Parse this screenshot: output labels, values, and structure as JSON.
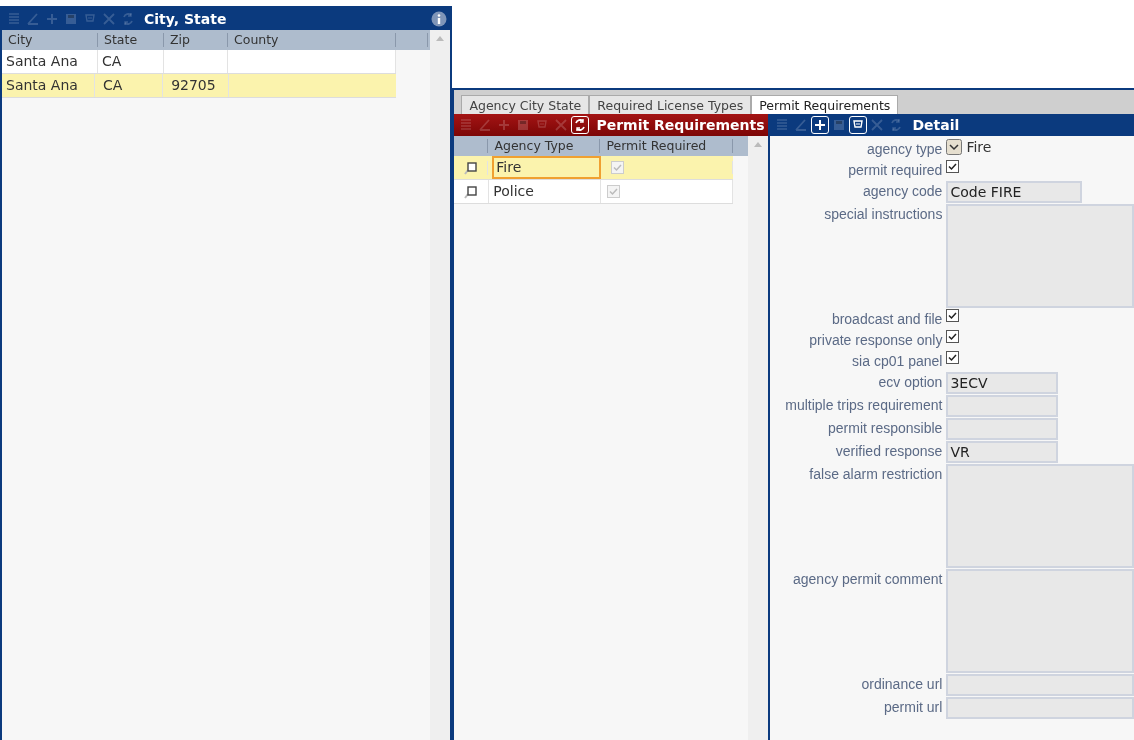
{
  "city_state_panel": {
    "title": "City, State",
    "toolbar": [
      {
        "kind": "list",
        "disabled": true
      },
      {
        "kind": "edit",
        "disabled": true
      },
      {
        "kind": "add",
        "disabled": true
      },
      {
        "kind": "save",
        "disabled": true
      },
      {
        "kind": "filter",
        "disabled": true
      },
      {
        "kind": "delete",
        "disabled": true
      },
      {
        "kind": "refresh",
        "disabled": true
      }
    ],
    "columns": [
      "City",
      "State",
      "Zip",
      "County"
    ],
    "rows": [
      {
        "city": "Santa Ana",
        "state": "CA",
        "selected": false
      },
      {
        "city": "Santa Ana",
        "state": "CA",
        "zip": "92705",
        "selected": true
      }
    ]
  },
  "tabs": [
    {
      "label": "Agency City State",
      "selected": false
    },
    {
      "label": "Required License Types",
      "selected": false
    },
    {
      "label": "Permit Requirements",
      "selected": true
    }
  ],
  "permit_panel": {
    "title": "Permit Requirements",
    "toolbar": [
      {
        "kind": "list",
        "disabled": true
      },
      {
        "kind": "edit",
        "disabled": true
      },
      {
        "kind": "add",
        "disabled": true
      },
      {
        "kind": "save",
        "disabled": true
      },
      {
        "kind": "filter",
        "disabled": true
      },
      {
        "kind": "delete",
        "disabled": true
      },
      {
        "kind": "refresh",
        "disabled": false
      }
    ],
    "columns": [
      "Agency Type",
      "Permit Required"
    ],
    "rows": [
      {
        "agency_type": "Fire",
        "permit_required": true,
        "selected": true,
        "focused": true
      },
      {
        "agency_type": "Police",
        "permit_required": true,
        "selected": false,
        "focused": false
      }
    ]
  },
  "detail_panel": {
    "title": "Detail",
    "toolbar": [
      {
        "kind": "list",
        "disabled": true
      },
      {
        "kind": "edit",
        "disabled": true
      },
      {
        "kind": "add",
        "disabled": false
      },
      {
        "kind": "save",
        "disabled": true
      },
      {
        "kind": "filter",
        "disabled": false
      },
      {
        "kind": "delete",
        "disabled": true
      },
      {
        "kind": "refresh",
        "disabled": true
      }
    ],
    "fields": [
      {
        "label": "agency type",
        "kind": "select",
        "value": "Fire"
      },
      {
        "label": "permit required",
        "kind": "checkbox",
        "checked": true
      },
      {
        "label": "agency code",
        "kind": "text",
        "value": "Code FIRE"
      },
      {
        "label": "special instructions",
        "kind": "textarea"
      },
      {
        "label": "broadcast and file",
        "kind": "checkbox",
        "checked": true
      },
      {
        "label": "private response only",
        "kind": "checkbox",
        "checked": true
      },
      {
        "label": "sia cp01 panel",
        "kind": "checkbox",
        "checked": true
      },
      {
        "label": "ecv option",
        "kind": "text",
        "value": "3ECV"
      },
      {
        "label": "multiple trips requirement",
        "kind": "text"
      },
      {
        "label": "permit responsible",
        "kind": "text"
      },
      {
        "label": "verified response",
        "kind": "text",
        "value": "VR"
      },
      {
        "label": "false alarm restriction",
        "kind": "textarea"
      },
      {
        "label": "agency permit comment",
        "kind": "textarea"
      },
      {
        "label": "ordinance url",
        "kind": "url"
      },
      {
        "label": "permit url",
        "kind": "url"
      }
    ]
  }
}
